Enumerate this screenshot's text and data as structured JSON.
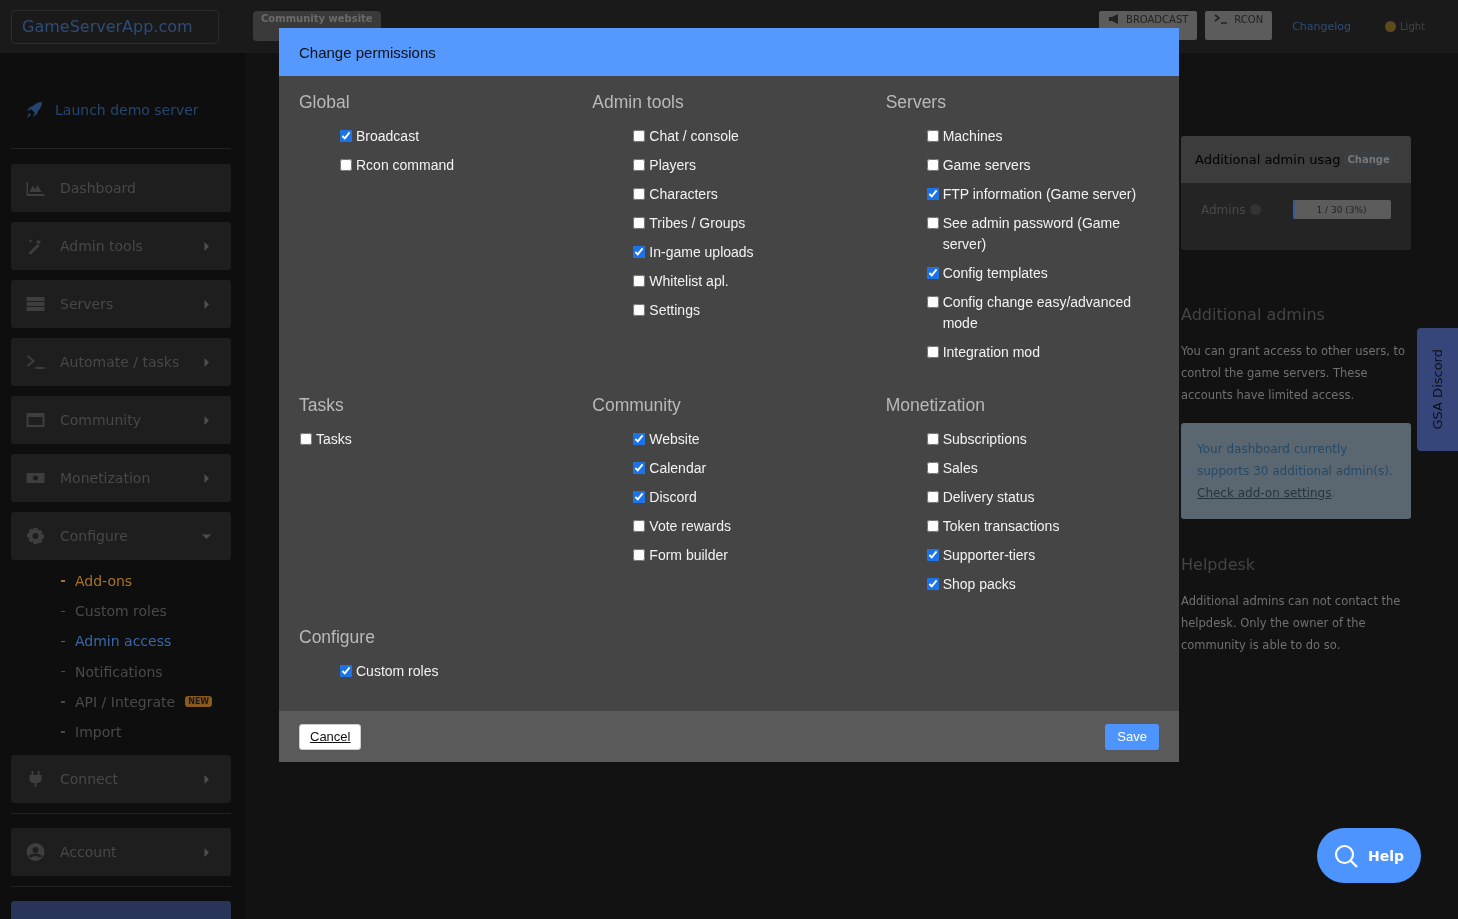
{
  "topbar": {
    "brand": "GameServerApp.com",
    "community_button": "Community website",
    "broadcast_button": "BROADCAST",
    "rcon_button": "RCON",
    "changelog_link": "Changelog",
    "theme_toggle": "Light"
  },
  "sidebar": {
    "launch_link": "Launch demo server",
    "items": [
      {
        "label": "Dashboard"
      },
      {
        "label": "Admin tools",
        "expanded": false
      },
      {
        "label": "Servers",
        "expanded": false
      },
      {
        "label": "Automate / tasks",
        "expanded": false
      },
      {
        "label": "Community",
        "expanded": false
      },
      {
        "label": "Monetization",
        "expanded": false
      },
      {
        "label": "Configure",
        "expanded": true,
        "children": [
          {
            "label": "Add-ons",
            "selected": false,
            "color": "#a8722c"
          },
          {
            "label": "Custom roles",
            "selected": false,
            "color": "#4a4a4a"
          },
          {
            "label": "Admin access",
            "selected": true,
            "color": "#3a68a8"
          },
          {
            "label": "Notifications",
            "selected": false,
            "color": "#4a4a4a"
          },
          {
            "label": "API / Integrate",
            "selected": false,
            "color": "#4a4a4a",
            "badge": "NEW"
          },
          {
            "label": "Import",
            "selected": false,
            "color": "#4a4a4a"
          }
        ]
      },
      {
        "label": "Connect",
        "expanded": false
      }
    ],
    "account_items": [
      {
        "label": "Account",
        "expanded": false
      }
    ]
  },
  "usage_card": {
    "title": "Additional admin usag",
    "change_button": "Change",
    "label": "Admins",
    "meter": {
      "level": 0.03,
      "reading": "1 / 30 (3%)"
    }
  },
  "info": [
    {
      "heading": "Additional admins",
      "text": "You can grant access to other users, to control the game servers. These accounts have limited access."
    },
    {
      "heading": "Helpdesk",
      "text": "Additional admins can not contact the helpdesk. Only the owner of the community is able to do so."
    }
  ],
  "notice": {
    "text": "Your dashboard currently supports 30 additional admin(s).",
    "link": "Check add-on settings",
    "after": "."
  },
  "discord_tab": "GSA Discord",
  "help_button": "Help",
  "modal": {
    "title": "Change permissions",
    "sections": [
      {
        "title": "Global",
        "indented": true,
        "items": [
          {
            "label": "Broadcast",
            "checked": true
          },
          {
            "label": "Rcon command",
            "checked": false
          }
        ]
      },
      {
        "title": "Admin tools",
        "indented": true,
        "items": [
          {
            "label": "Chat / console",
            "checked": false
          },
          {
            "label": "Players",
            "checked": false
          },
          {
            "label": "Characters",
            "checked": false
          },
          {
            "label": "Tribes / Groups",
            "checked": false
          },
          {
            "label": "In-game uploads",
            "checked": true
          },
          {
            "label": "Whitelist apl.",
            "checked": false
          },
          {
            "label": "Settings",
            "checked": false
          }
        ]
      },
      {
        "title": "Servers",
        "indented": true,
        "items": [
          {
            "label": "Machines",
            "checked": false
          },
          {
            "label": "Game servers",
            "checked": false
          },
          {
            "label": "FTP information (Game server)",
            "checked": true
          },
          {
            "label": "See admin password (Game server)",
            "checked": false
          },
          {
            "label": "Config templates",
            "checked": true
          },
          {
            "label": "Config change easy/advanced mode",
            "checked": false
          },
          {
            "label": "Integration mod",
            "checked": false
          }
        ]
      },
      {
        "title": "Tasks",
        "indented": false,
        "items": [
          {
            "label": "Tasks",
            "checked": false
          }
        ]
      },
      {
        "title": "Community",
        "indented": true,
        "items": [
          {
            "label": "Website",
            "checked": true
          },
          {
            "label": "Calendar",
            "checked": true
          },
          {
            "label": "Discord",
            "checked": true
          },
          {
            "label": "Vote rewards",
            "checked": false
          },
          {
            "label": "Form builder",
            "checked": false
          }
        ]
      },
      {
        "title": "Monetization",
        "indented": true,
        "items": [
          {
            "label": "Subscriptions",
            "checked": false
          },
          {
            "label": "Sales",
            "checked": false
          },
          {
            "label": "Delivery status",
            "checked": false
          },
          {
            "label": "Token transactions",
            "checked": false
          },
          {
            "label": "Supporter-tiers",
            "checked": true
          },
          {
            "label": "Shop packs",
            "checked": true
          }
        ]
      },
      {
        "title": "Configure",
        "indented": true,
        "items": [
          {
            "label": "Custom roles",
            "checked": true
          }
        ]
      }
    ],
    "cancel_button": "Cancel",
    "save_button": "Save"
  }
}
